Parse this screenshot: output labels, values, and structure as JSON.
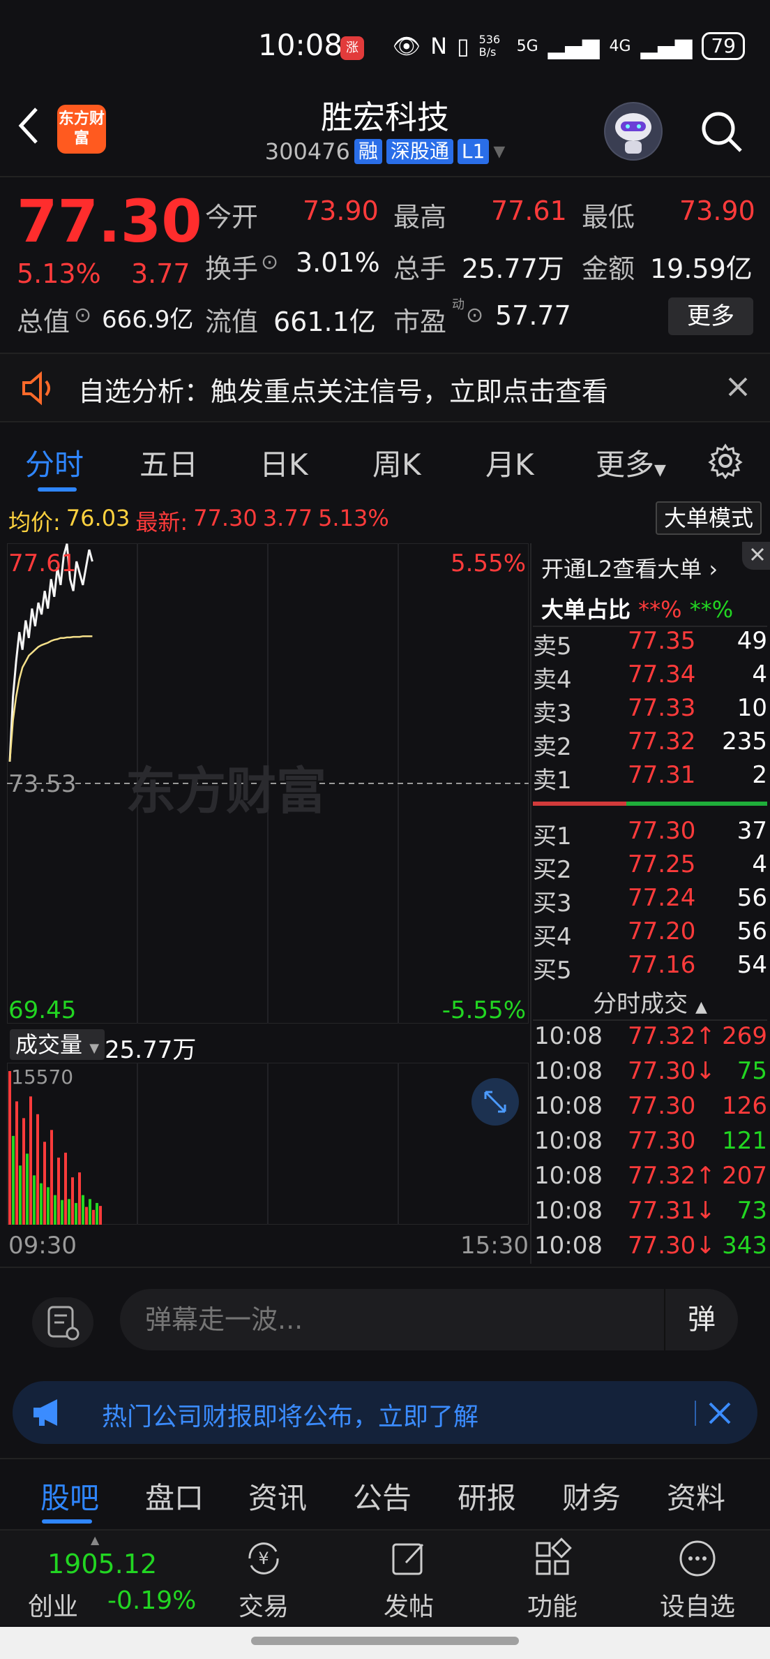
{
  "status_bar": {
    "time": "10:08",
    "badge": "涨",
    "net_speed": "536 B/s",
    "signal_1": "5G",
    "signal_2": "4G",
    "battery": "79"
  },
  "header": {
    "title": "胜宏科技",
    "code": "300476",
    "tags": [
      "融",
      "深股通",
      "L1"
    ],
    "logo_text": "东方财富"
  },
  "quote": {
    "price": "77.30",
    "pct": "5.13%",
    "change": "3.77",
    "open_label": "今开",
    "open": "73.90",
    "high_label": "最高",
    "high": "77.61",
    "low_label": "最低",
    "low": "73.90",
    "turnover_label": "换手",
    "turnover": "3.01%",
    "volume_label": "总手",
    "volume": "25.77万",
    "amount_label": "金额",
    "amount": "19.59亿",
    "mktcap_label": "总值",
    "mktcap": "666.9亿",
    "float_label": "流值",
    "float": "661.1亿",
    "pe_label": "市盈",
    "pe_sup": "动",
    "pe": "57.77",
    "more_label": "更多"
  },
  "alert": {
    "text": "自选分析：触发重点关注信号，立即点击查看"
  },
  "tabs": [
    "分时",
    "五日",
    "日K",
    "周K",
    "月K",
    "更多"
  ],
  "chart_info": {
    "avg_label": "均价:",
    "avg": "76.03",
    "latest_label": "最新:",
    "latest": "77.30",
    "change": "3.77",
    "pct": "5.13%",
    "dadan_button": "大单模式",
    "watermark": "东方财富"
  },
  "chart_data": {
    "type": "line",
    "title": "",
    "ylim": [
      69.45,
      77.61
    ],
    "y_ticks_left": [
      "77.61",
      "73.53",
      "69.45"
    ],
    "y_ticks_right": [
      "5.55%",
      "-5.55%"
    ],
    "x_labels": [
      "09:30",
      "15:30"
    ],
    "series": [
      {
        "values": [
          73.9,
          75.0,
          75.6,
          76.1,
          75.8,
          76.3,
          76.0,
          76.5,
          76.2,
          76.6,
          76.4,
          76.8,
          76.5,
          77.0,
          76.7,
          77.2,
          76.9,
          77.4,
          77.6,
          77.0,
          76.8,
          77.3,
          77.1,
          76.9,
          77.2,
          77.5,
          77.3
        ]
      },
      {
        "values": [
          73.9,
          74.6,
          75.0,
          75.3,
          75.5,
          75.6,
          75.7,
          75.75,
          75.8,
          75.85,
          75.88,
          75.9,
          75.92,
          75.95,
          75.97,
          75.98,
          76.0,
          76.0,
          76.01,
          76.01,
          76.02,
          76.02,
          76.02,
          76.03,
          76.03,
          76.03,
          76.03
        ]
      }
    ]
  },
  "volume_panel": {
    "label": "成交量",
    "total": "25.77万",
    "max_tick": "15570",
    "chart_data": {
      "type": "bar",
      "values": [
        15570,
        9000,
        12500,
        6000,
        10800,
        7200,
        13000,
        5000,
        11200,
        4200,
        8400,
        3800,
        9600,
        3000,
        6800,
        2500,
        7300,
        2600,
        4800,
        2200,
        5300,
        3000,
        1800,
        2600,
        1500,
        2200,
        1900
      ]
    }
  },
  "order_book": {
    "header": "开通L2查看大单",
    "ratio_label": "大单占比",
    "ratio_red": "**%",
    "ratio_green": "**%",
    "asks": [
      {
        "label": "卖5",
        "price": "77.35",
        "vol": "49"
      },
      {
        "label": "卖4",
        "price": "77.34",
        "vol": "4"
      },
      {
        "label": "卖3",
        "price": "77.33",
        "vol": "10"
      },
      {
        "label": "卖2",
        "price": "77.32",
        "vol": "235"
      },
      {
        "label": "卖1",
        "price": "77.31",
        "vol": "2"
      }
    ],
    "bids": [
      {
        "label": "买1",
        "price": "77.30",
        "vol": "37"
      },
      {
        "label": "买2",
        "price": "77.25",
        "vol": "4"
      },
      {
        "label": "买3",
        "price": "77.24",
        "vol": "56"
      },
      {
        "label": "买4",
        "price": "77.20",
        "vol": "56"
      },
      {
        "label": "买5",
        "price": "77.16",
        "vol": "54"
      }
    ],
    "trades_title": "分时成交",
    "trades": [
      {
        "time": "10:08",
        "price": "77.32↑",
        "vol": "269",
        "dir": "up"
      },
      {
        "time": "10:08",
        "price": "77.30↓",
        "vol": "75",
        "dir": "down"
      },
      {
        "time": "10:08",
        "price": "77.30",
        "vol": "126",
        "dir": "up"
      },
      {
        "time": "10:08",
        "price": "77.30",
        "vol": "121",
        "dir": "down"
      },
      {
        "time": "10:08",
        "price": "77.32↑",
        "vol": "207",
        "dir": "up"
      },
      {
        "time": "10:08",
        "price": "77.31↓",
        "vol": "73",
        "dir": "down"
      },
      {
        "time": "10:08",
        "price": "77.30↓",
        "vol": "343",
        "dir": "down"
      }
    ]
  },
  "danmu": {
    "placeholder": "弹幕走一波...",
    "send": "弹"
  },
  "notice": {
    "text": "热门公司财报即将公布，立即了解"
  },
  "subnav": [
    "股吧",
    "盘口",
    "资讯",
    "公告",
    "研报",
    "财务",
    "资料"
  ],
  "bottom_bar": {
    "index_value": "1905.12",
    "index_name": "创业",
    "index_pct": "-0.19%",
    "items": [
      "交易",
      "发帖",
      "功能",
      "设自选"
    ]
  },
  "colors": {
    "up": "#ff3b3b",
    "down": "#22d622",
    "accent": "#2f86ff",
    "bg": "#111114"
  }
}
